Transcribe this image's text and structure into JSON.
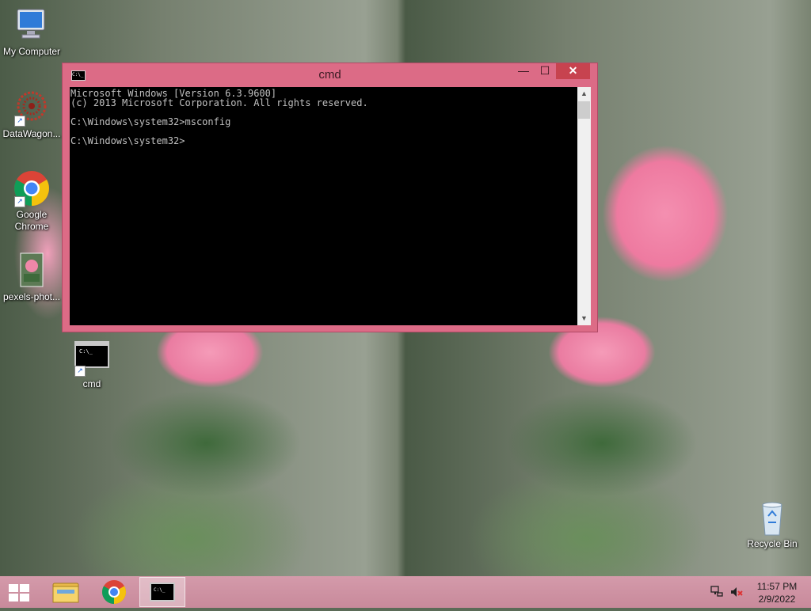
{
  "desktop": {
    "icons": [
      {
        "label": "My Computer"
      },
      {
        "label": "DataWagon..."
      },
      {
        "label": "Google Chrome"
      },
      {
        "label": "pexels-phot..."
      },
      {
        "label": "cmd"
      },
      {
        "label": "Recycle Bin"
      }
    ]
  },
  "cmd_window": {
    "title": "cmd",
    "icon_text": "C:\\_",
    "buttons": {
      "minimize": "—",
      "maximize": "☐",
      "close": "✕"
    },
    "console_lines": [
      "Microsoft Windows [Version 6.3.9600]",
      "(c) 2013 Microsoft Corporation. All rights reserved.",
      "",
      "C:\\Windows\\system32>msconfig",
      "",
      "C:\\Windows\\system32>"
    ]
  },
  "taskbar": {
    "items": [
      "start",
      "file-explorer",
      "google-chrome",
      "cmd"
    ],
    "clock_time": "11:57 PM",
    "clock_date": "2/9/2022"
  }
}
